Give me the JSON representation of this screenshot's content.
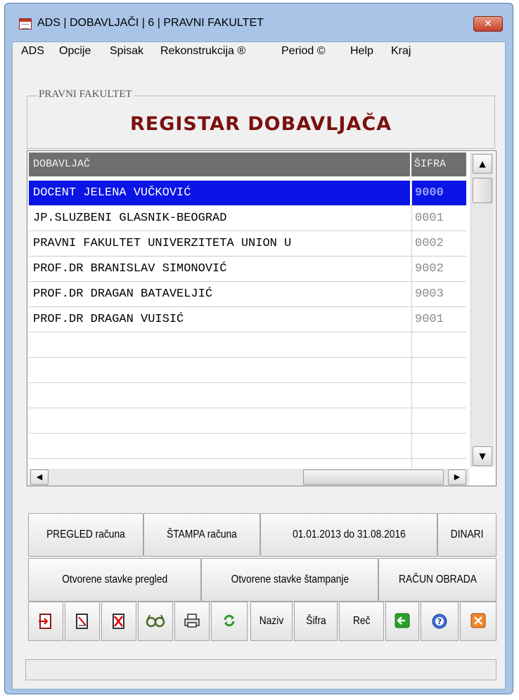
{
  "window": {
    "title": "ADS | DOBAVLJAČI | 6 | PRAVNI FAKULTET",
    "close_glyph": "✕"
  },
  "menu": [
    "ADS",
    "Opcije",
    "Spisak",
    "Rekonstrukcija ®",
    "Period ©",
    "Help",
    "Kraj"
  ],
  "group": {
    "legend": "PRAVNI FAKULTET",
    "title": "REGISTAR DOBAVLJAČA"
  },
  "grid": {
    "columns": {
      "name": "DOBAVLJAČ",
      "code": "ŠIFRA"
    },
    "rows": [
      {
        "name": "DOCENT JELENA VUČKOVIĆ",
        "code": "9000",
        "selected": true
      },
      {
        "name": "JP.SLUZBENI GLASNIK-BEOGRAD",
        "code": "0001"
      },
      {
        "name": "PRAVNI FAKULTET UNIVERZITETA UNION U",
        "code": "0002"
      },
      {
        "name": "PROF.DR BRANISLAV SIMONOVIĆ",
        "code": "9002"
      },
      {
        "name": "PROF.DR DRAGAN BATAVELJIĆ",
        "code": "9003"
      },
      {
        "name": "PROF.DR DRAGAN VUISIĆ",
        "code": "9001"
      }
    ],
    "selected_color": "#0a14e6"
  },
  "buttons": {
    "row1": [
      "PREGLED računa",
      "ŠTAMPA računa",
      "01.01.2013 do 31.08.2016",
      "DINARI"
    ],
    "row2": [
      "Otvorene stavke pregled",
      "Otvorene stavke štampanje",
      "RAČUN OBRADA"
    ]
  },
  "toolbar": {
    "icons": [
      "import-icon",
      "edit-icon",
      "delete-icon",
      "view-glasses-icon",
      "print-icon",
      "refresh-icon"
    ],
    "text_buttons": [
      "Naziv",
      "Šifra",
      "Reč"
    ],
    "end_icons": [
      "back-arrow-icon",
      "help-icon",
      "exit-icon"
    ]
  }
}
